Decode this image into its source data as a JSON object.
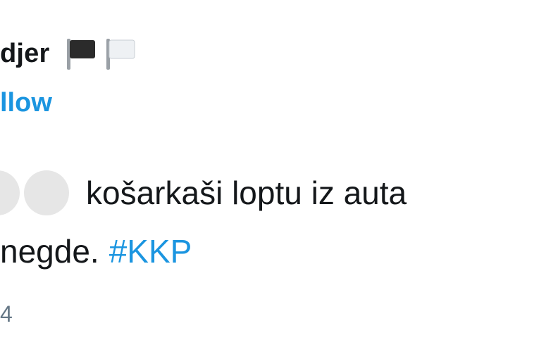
{
  "tweet": {
    "display_name": "djer",
    "flag_icons": [
      "black-flag-icon",
      "white-flag-icon"
    ],
    "follow_label": "llow",
    "body_line_1": "košarkaši loptu iz auta",
    "body_line_2_text": "negde.",
    "hashtag": "#KKP",
    "meta_fragment": "4"
  },
  "colors": {
    "link_blue": "#1b95e0",
    "text_dark": "#14171a",
    "meta_gray": "#657786",
    "emoji_placeholder": "#e6e6e6"
  }
}
